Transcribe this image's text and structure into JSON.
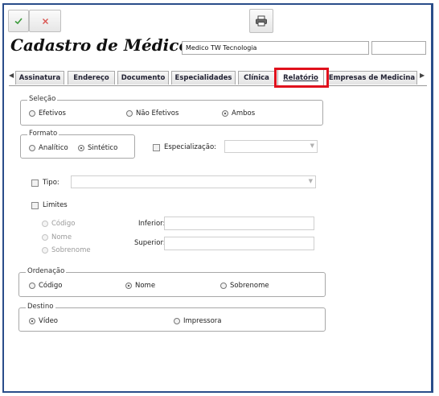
{
  "toolbar": {
    "confirm_icon": "checkmark-icon",
    "cancel_icon": "x-icon",
    "print_icon": "printer-icon"
  },
  "header": {
    "title": "Cadastro de Médicos",
    "name_value": "Medico TW Tecnologia",
    "extra_value": ""
  },
  "tabs": [
    {
      "label": "Assinatura",
      "active": false
    },
    {
      "label": "Endereço",
      "active": false
    },
    {
      "label": "Documento",
      "active": false
    },
    {
      "label": "Especialidades",
      "active": false
    },
    {
      "label": "Clínica",
      "active": false
    },
    {
      "label": "Relatório",
      "active": true
    },
    {
      "label": "Empresas de Medicina",
      "active": false
    }
  ],
  "selecao": {
    "legend": "Seleção",
    "options": [
      "Efetivos",
      "Não Efetivos",
      "Ambos"
    ],
    "selected": "Ambos"
  },
  "formato": {
    "legend": "Formato",
    "options": [
      "Analítico",
      "Sintético"
    ],
    "selected": "Sintético"
  },
  "especializacao": {
    "label": "Especialização:",
    "checked": false,
    "value": ""
  },
  "tipo": {
    "label": "Tipo:",
    "checked": false,
    "value": ""
  },
  "limites": {
    "label": "Limites",
    "checked": false,
    "options": [
      "Código",
      "Nome",
      "Sobrenome"
    ],
    "inferior_label": "Inferior:",
    "superior_label": "Superior:",
    "inferior_value": "",
    "superior_value": ""
  },
  "ordenacao": {
    "legend": "Ordenação",
    "options": [
      "Código",
      "Nome",
      "Sobrenome"
    ],
    "selected": "Nome"
  },
  "destino": {
    "legend": "Destino",
    "options": [
      "Vídeo",
      "Impressora"
    ],
    "selected": "Vídeo"
  },
  "colors": {
    "border_blue": "#2a4d8a",
    "highlight_red": "#e0101c",
    "confirm_green": "#3a9a3a",
    "cancel_red": "#d9534f"
  }
}
